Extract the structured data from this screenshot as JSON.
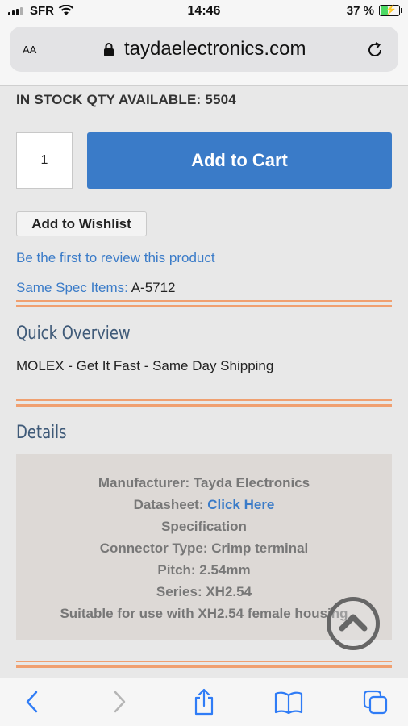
{
  "status_bar": {
    "carrier": "SFR",
    "time": "14:46",
    "battery_percent": "37 %"
  },
  "browser": {
    "text_size_label": "AA",
    "domain": "taydaelectronics.com"
  },
  "product": {
    "stock_text": "IN STOCK QTY AVAILABLE: 5504",
    "quantity": "1",
    "add_to_cart_label": "Add to Cart",
    "add_to_wishlist_label": "Add to Wishlist",
    "review_link": "Be the first to review this product",
    "same_spec_label": "Same Spec Items:",
    "same_spec_value": "A-5712"
  },
  "quick_overview": {
    "title": "Quick Overview",
    "text": "MOLEX - Get It Fast - Same Day Shipping"
  },
  "details": {
    "title": "Details",
    "manufacturer": "Manufacturer: Tayda Electronics",
    "datasheet_label": "Datasheet:",
    "datasheet_link": "Click Here",
    "specification": "Specification",
    "connector_type": "Connector Type: Crimp terminal",
    "pitch": "Pitch: 2.54mm",
    "series": "Series: XH2.54",
    "suitable": "Suitable for use with XH2.54 female housing"
  },
  "colors": {
    "accent_blue": "#3a7bc8",
    "divider_orange": "#f0a070",
    "section_title": "#3f5a78"
  },
  "icons": {
    "back": "chevron-left-icon",
    "forward": "chevron-right-icon",
    "share": "share-icon",
    "bookmarks": "book-icon",
    "tabs": "tabs-icon",
    "scroll_top": "chevron-up-circle-icon"
  }
}
